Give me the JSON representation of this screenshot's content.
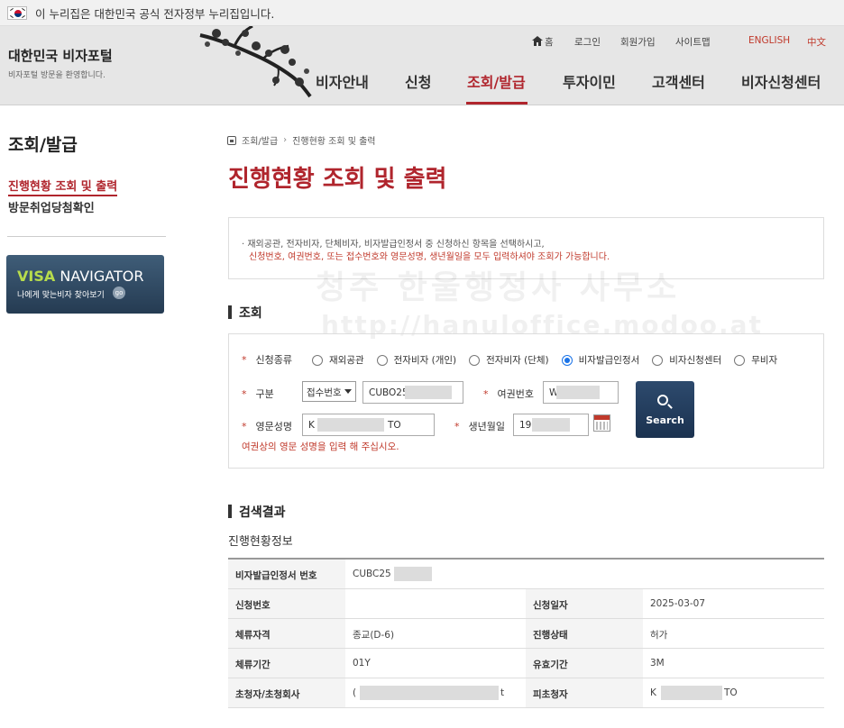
{
  "gov_banner": {
    "text": "이 누리집은 대한민국 공식 전자정부 누리집입니다."
  },
  "header": {
    "site_title": "대한민국 비자포털",
    "site_subtitle": "비자포털 방문을 환영합니다.",
    "util_links": {
      "home": "홈",
      "login": "로그인",
      "join": "회원가입",
      "sitemap": "사이트맵",
      "english": "ENGLISH",
      "chinese": "中文"
    },
    "gnb": [
      "비자안내",
      "신청",
      "조회/발급",
      "투자이민",
      "고객센터",
      "비자신청센터"
    ],
    "gnb_active": "조회/발급"
  },
  "lnb": {
    "title": "조회/발급",
    "items": [
      {
        "label": "진행현황 조회 및 출력",
        "active": true
      },
      {
        "label": "방문취업당첨확인",
        "active": false
      }
    ],
    "banner": {
      "title_a": "VISA",
      "title_b": "NAVIGATOR",
      "sub": "나에게 맞는비자 찾아보기",
      "go": "go"
    }
  },
  "breadcrumb": [
    "조회/발급",
    "진행현황 조회 및 출력"
  ],
  "page_title": "진행현황 조회 및 출력",
  "notice": {
    "line1": "· 재외공관, 전자비자, 단체비자, 비자발급인정서 중 신청하신 항목을 선택하시고,",
    "line2": "신청번호, 여권번호, 또는 접수번호와 영문성명, 생년월일을 모두 입력하셔야 조회가 가능합니다."
  },
  "watermark": {
    "line1": "청주 한울행정사 사무소",
    "line2": "http://hanuloffice.modoo.at"
  },
  "search": {
    "heading": "조회",
    "apply_type": {
      "label": "신청종류",
      "options": [
        "재외공관",
        "전자비자 (개인)",
        "전자비자 (단체)",
        "비자발급인정서",
        "비자신청센터",
        "무비자"
      ],
      "selected": "비자발급인정서"
    },
    "category": {
      "label": "구분",
      "select_value": "접수번호",
      "input_value": "CUBO25"
    },
    "passport": {
      "label": "여권번호",
      "value": "W"
    },
    "english_name": {
      "label": "영문성명",
      "value_start": "K",
      "value_end": "TO"
    },
    "birthdate": {
      "label": "생년월일",
      "value": "19"
    },
    "search_button": "Search",
    "hint": "여권상의 영문 성명을 입력 해 주십시오."
  },
  "results": {
    "heading": "검색결과",
    "subheading": "진행현황정보",
    "rows": [
      {
        "th1": "비자발급인정서 번호",
        "td1": "CUBC25"
      },
      {
        "th1": "신청번호",
        "td1": "",
        "th2": "신청일자",
        "td2": "2025-03-07"
      },
      {
        "th1": "체류자격",
        "td1": "종교(D-6)",
        "th2": "진행상태",
        "td2": "허가"
      },
      {
        "th1": "체류기간",
        "td1": "01Y",
        "th2": "유효기간",
        "td2": "3M"
      },
      {
        "th1": "초청자/초청회사",
        "td1": "(",
        "td1_end": "t",
        "th2": "피초청자",
        "td2": "K",
        "td2_end": "TO"
      }
    ]
  },
  "colors": {
    "accent": "#b0252d",
    "notice_red": "#c0392b",
    "button_navy": "#1b3250"
  }
}
